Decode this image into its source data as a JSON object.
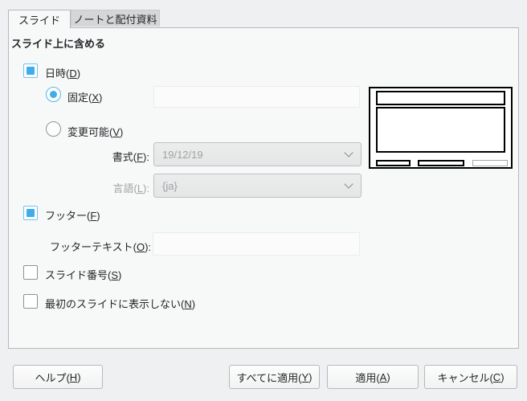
{
  "dialog": {
    "tabs": [
      {
        "label": "スライド",
        "active": true
      },
      {
        "label": "ノートと配付資料",
        "active": false
      }
    ],
    "section_title": "スライド上に含める",
    "date_time": {
      "label": "日時(D)",
      "checked": true
    },
    "fixed": {
      "label": "固定(X)",
      "selected": true,
      "value": ""
    },
    "variable": {
      "label": "変更可能(V)",
      "selected": false
    },
    "format": {
      "label": "書式(F):",
      "value": "19/12/19",
      "disabled": true
    },
    "language": {
      "label": "言語(L):",
      "value": "{ja}",
      "disabled": true
    },
    "footer": {
      "label": "フッター(F)",
      "checked": true
    },
    "footer_text": {
      "label": "フッターテキスト(O):",
      "value": ""
    },
    "slide_number": {
      "label": "スライド番号(S)",
      "checked": false
    },
    "not_on_first_slide": {
      "label": "最初のスライドに表示しない(N)",
      "checked": false
    },
    "buttons": {
      "help": "ヘルプ(H)",
      "apply_all": "すべてに適用(Y)",
      "apply": "適用(A)",
      "cancel": "キャンセル(C)"
    },
    "icons": {
      "dropdown": "chevron-down"
    },
    "colors": {
      "accent": "#3daee9",
      "window_bg": "#eff0f1",
      "page_bg": "#f7f8f8",
      "inactive_tab_bg": "#d5d6d7",
      "border": "#b6b9bb",
      "text": "#232629",
      "disabled_text": "#9ea1a4"
    }
  }
}
